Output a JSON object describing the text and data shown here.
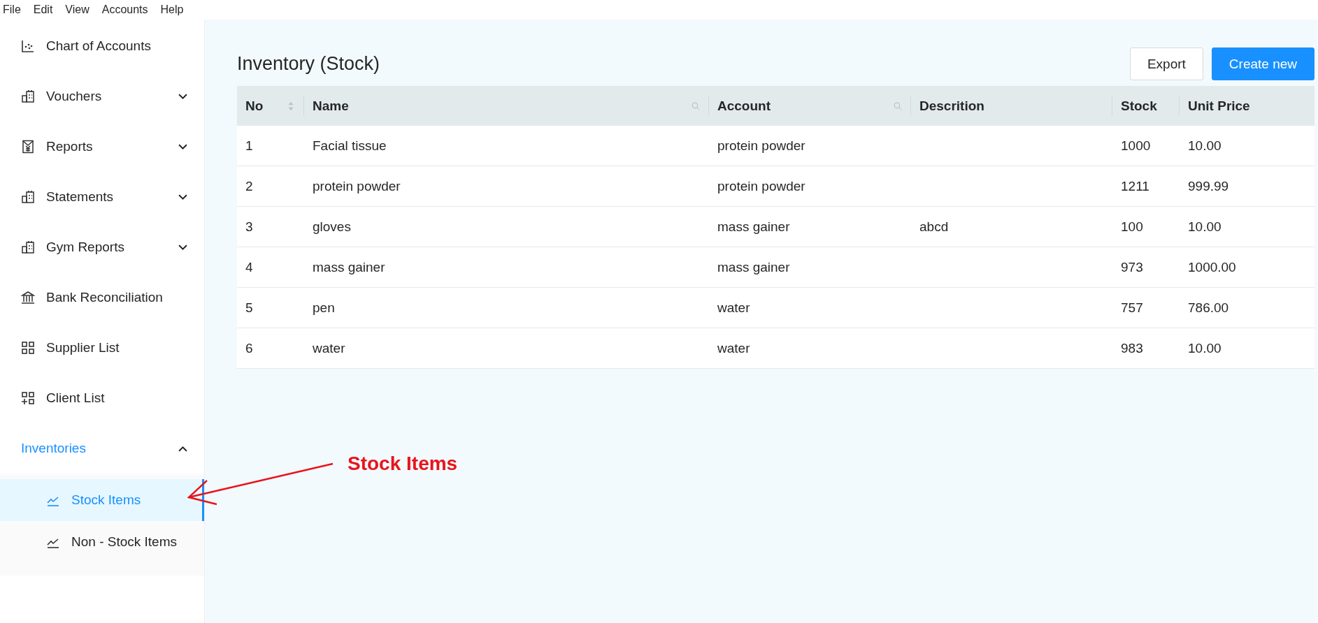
{
  "menu_bar": [
    "File",
    "Edit",
    "View",
    "Accounts",
    "Help"
  ],
  "sidebar": {
    "items": [
      {
        "label": "Chart of Accounts",
        "kind": "link",
        "selected": false
      },
      {
        "label": "Vouchers",
        "kind": "submenu",
        "expanded": false,
        "selected": false
      },
      {
        "label": "Reports",
        "kind": "submenu",
        "expanded": false,
        "selected": false
      },
      {
        "label": "Statements",
        "kind": "submenu",
        "expanded": false,
        "selected": false
      },
      {
        "label": "Gym Reports",
        "kind": "submenu",
        "expanded": false,
        "selected": false
      },
      {
        "label": "Bank Reconciliation",
        "kind": "link",
        "selected": false
      },
      {
        "label": "Supplier List",
        "kind": "link",
        "selected": false
      },
      {
        "label": "Client List",
        "kind": "link",
        "selected": false
      },
      {
        "label": "Inventories",
        "kind": "submenu",
        "expanded": true,
        "selected": true,
        "children": [
          {
            "label": "Stock Items",
            "selected": true
          },
          {
            "label": "Non - Stock Items",
            "selected": false
          }
        ]
      }
    ]
  },
  "page": {
    "title": "Inventory (Stock)",
    "buttons": [
      {
        "label": "Export",
        "kind": "default"
      },
      {
        "label": "Create new",
        "kind": "primary"
      }
    ]
  },
  "table": {
    "columns": [
      {
        "label": "No",
        "sortable": true,
        "searchable": false
      },
      {
        "label": "Name",
        "sortable": false,
        "searchable": true
      },
      {
        "label": "Account",
        "sortable": false,
        "searchable": true
      },
      {
        "label": "Descrition",
        "sortable": false,
        "searchable": false
      },
      {
        "label": "Stock",
        "sortable": false,
        "searchable": false
      },
      {
        "label": "Unit Price",
        "sortable": false,
        "searchable": false
      }
    ],
    "rows": [
      [
        "1",
        "Facial tissue",
        "protein powder",
        "",
        "1000",
        "10.00"
      ],
      [
        "2",
        "protein powder",
        "protein powder",
        "",
        "1211",
        "999.99"
      ],
      [
        "3",
        "gloves",
        "mass gainer",
        "abcd",
        "100",
        "10.00"
      ],
      [
        "4",
        "mass gainer",
        "mass gainer",
        "",
        "973",
        "1000.00"
      ],
      [
        "5",
        "pen",
        "water",
        "",
        "757",
        "786.00"
      ],
      [
        "6",
        "water",
        "water",
        "",
        "983",
        "10.00"
      ]
    ]
  },
  "annotation": {
    "label": "Stock Items"
  }
}
